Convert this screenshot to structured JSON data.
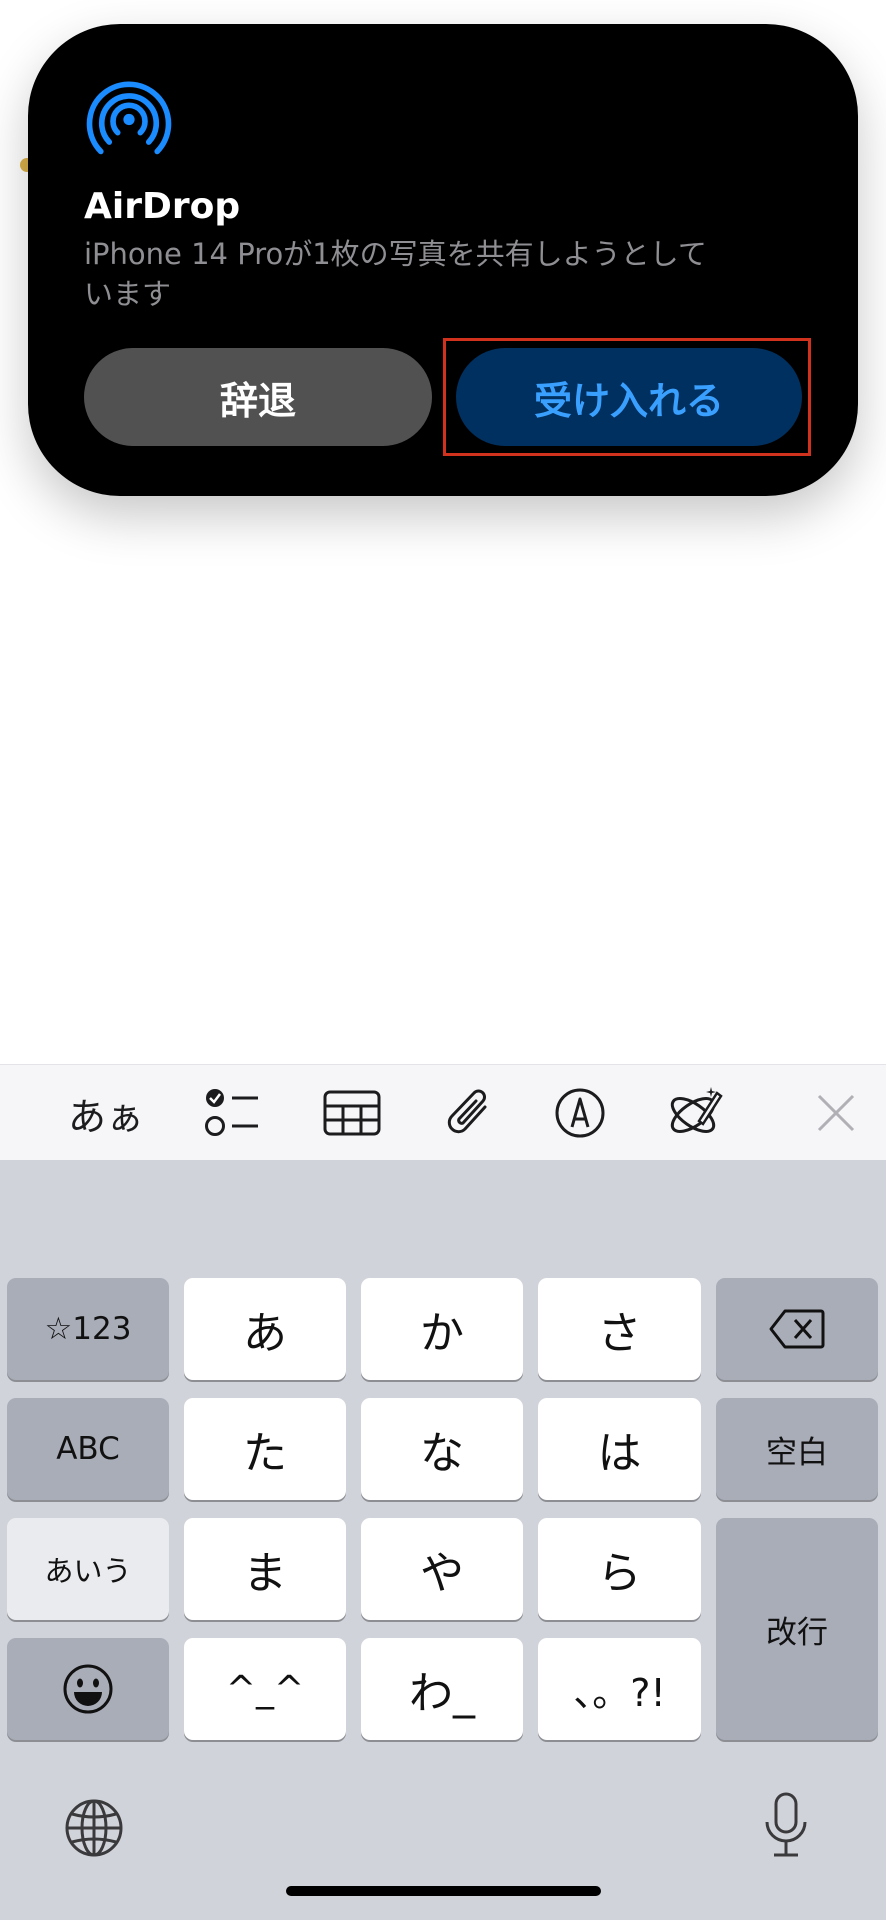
{
  "airdrop": {
    "title": "AirDrop",
    "message": "iPhone 14 Proが1枚の写真を共有しようとしています",
    "decline_label": "辞退",
    "accept_label": "受け入れる",
    "accent_color": "#1a8cff",
    "accept_text_color": "#3aa0ff"
  },
  "toolbar": {
    "items": [
      {
        "label": "あぁ",
        "icon": "text-format-icon"
      },
      {
        "icon": "checklist-icon"
      },
      {
        "icon": "table-icon"
      },
      {
        "icon": "paperclip-icon"
      },
      {
        "icon": "markup-pen-icon"
      },
      {
        "icon": "writing-tools-icon"
      },
      {
        "icon": "close-icon"
      }
    ]
  },
  "keyboard": {
    "rows": [
      [
        "☆123",
        "あ",
        "か",
        "さ",
        "delete"
      ],
      [
        "ABC",
        "た",
        "な",
        "は",
        "空白"
      ],
      [
        "あいう",
        "ま",
        "や",
        "ら",
        "改行"
      ],
      [
        "emoji",
        "^_^",
        "わ_",
        "、。?!"
      ]
    ],
    "left_keys": [
      "☆123",
      "ABC",
      "あいう"
    ],
    "main_keys": [
      "あ",
      "か",
      "さ",
      "た",
      "な",
      "は",
      "ま",
      "や",
      "ら",
      "^_^",
      "わ_",
      "、。?!"
    ],
    "space_label": "空白",
    "return_label": "改行",
    "bottom": {
      "globe": "globe-icon",
      "mic": "microphone-icon"
    }
  }
}
